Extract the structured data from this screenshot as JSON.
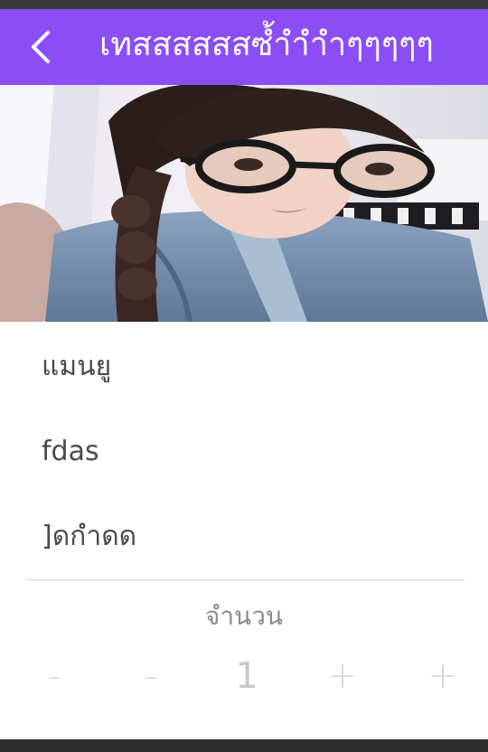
{
  "header": {
    "title": "เทสสสสสสซ้ำำำำๆๆๆๆๆ",
    "back_icon": "chevron-left-icon",
    "background_color": "#8b4ef5"
  },
  "product": {
    "name": "แมนยู",
    "detail": "fdas",
    "note": "]ดกำดด"
  },
  "quantity": {
    "label": "จำนวน",
    "value": "1",
    "decrease_fast_label": "-",
    "decrease_label": "-",
    "increase_label": "+",
    "increase_fast_label": "+"
  }
}
